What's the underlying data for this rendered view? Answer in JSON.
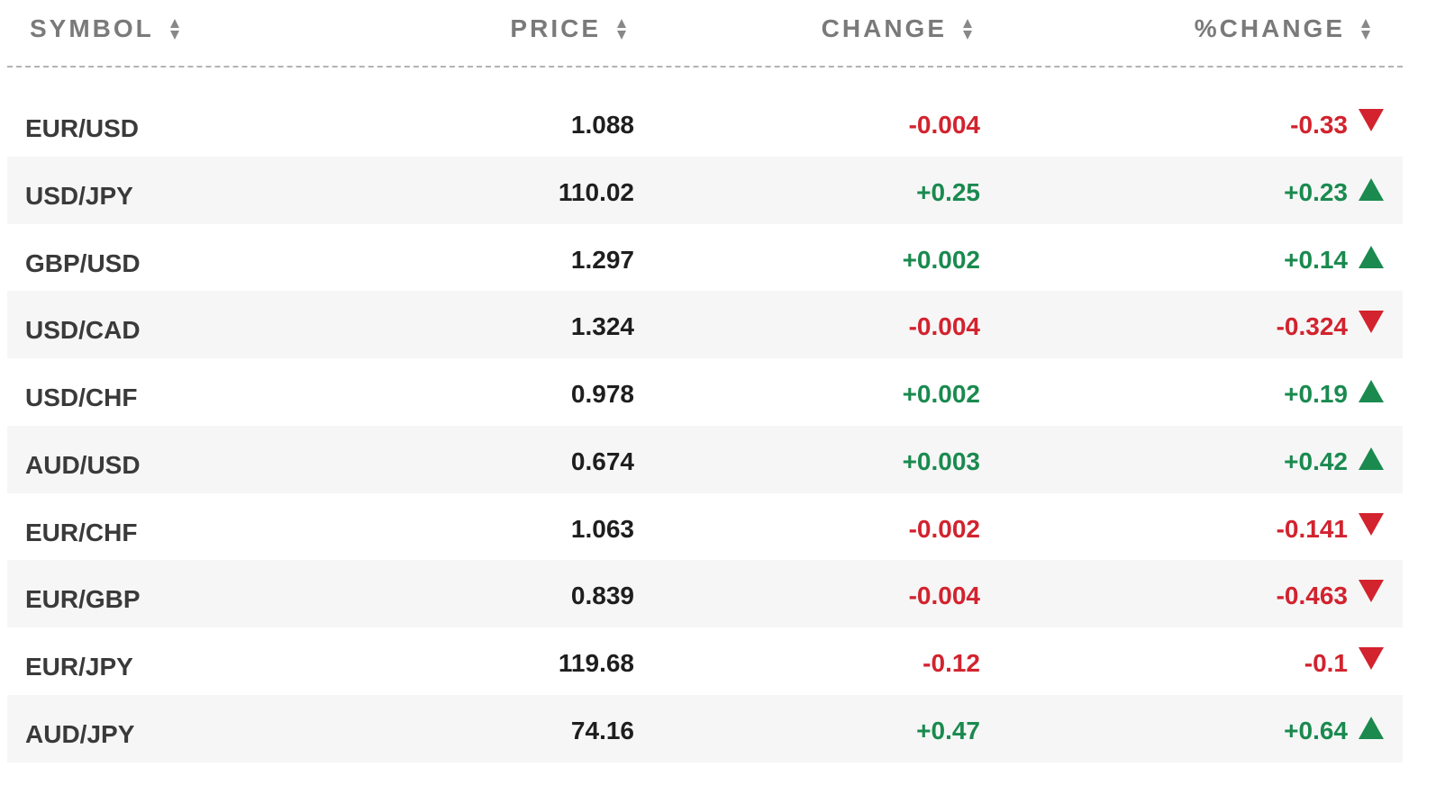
{
  "columns": {
    "symbol": "SYMBOL",
    "price": "PRICE",
    "change": "CHANGE",
    "pct_change": "%CHANGE"
  },
  "colors": {
    "negative": "#d2232e",
    "positive": "#1a8a4f",
    "header_text": "#7a7a7a",
    "alt_row_bg": "#f6f6f6"
  },
  "rows": [
    {
      "symbol": "EUR/USD",
      "price": "1.088",
      "change": "-0.004",
      "pct_change": "-0.33",
      "direction": "down"
    },
    {
      "symbol": "USD/JPY",
      "price": "110.02",
      "change": "+0.25",
      "pct_change": "+0.23",
      "direction": "up"
    },
    {
      "symbol": "GBP/USD",
      "price": "1.297",
      "change": "+0.002",
      "pct_change": "+0.14",
      "direction": "up"
    },
    {
      "symbol": "USD/CAD",
      "price": "1.324",
      "change": "-0.004",
      "pct_change": "-0.324",
      "direction": "down"
    },
    {
      "symbol": "USD/CHF",
      "price": "0.978",
      "change": "+0.002",
      "pct_change": "+0.19",
      "direction": "up"
    },
    {
      "symbol": "AUD/USD",
      "price": "0.674",
      "change": "+0.003",
      "pct_change": "+0.42",
      "direction": "up"
    },
    {
      "symbol": "EUR/CHF",
      "price": "1.063",
      "change": "-0.002",
      "pct_change": "-0.141",
      "direction": "down"
    },
    {
      "symbol": "EUR/GBP",
      "price": "0.839",
      "change": "-0.004",
      "pct_change": "-0.463",
      "direction": "down"
    },
    {
      "symbol": "EUR/JPY",
      "price": "119.68",
      "change": "-0.12",
      "pct_change": "-0.1",
      "direction": "down"
    },
    {
      "symbol": "AUD/JPY",
      "price": "74.16",
      "change": "+0.47",
      "pct_change": "+0.64",
      "direction": "up"
    }
  ]
}
